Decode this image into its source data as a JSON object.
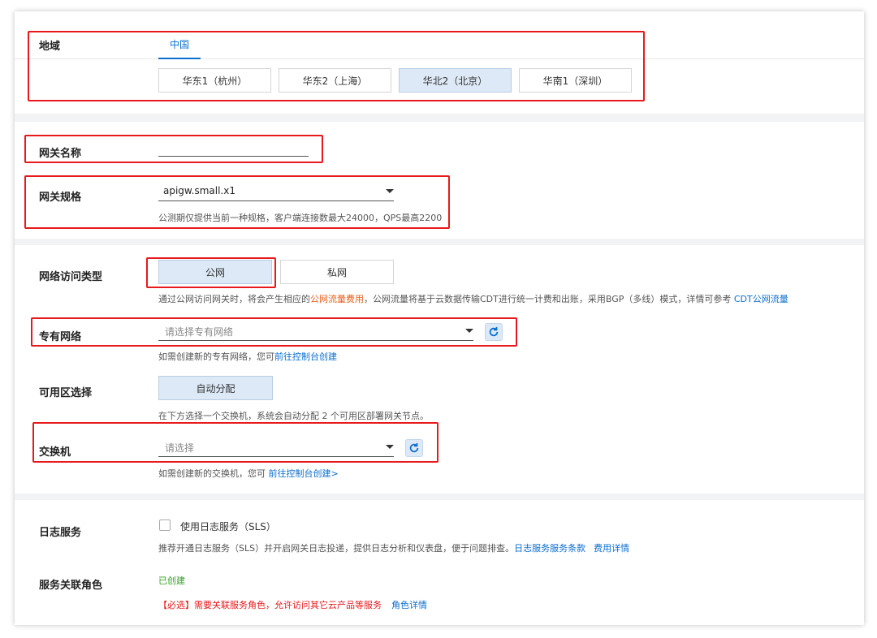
{
  "region": {
    "label": "地域",
    "tab": "中国",
    "options": [
      "华东1（杭州）",
      "华东2（上海）",
      "华北2（北京）",
      "华南1（深圳）"
    ],
    "selected_index": 2
  },
  "gateway_name": {
    "label": "网关名称",
    "value": ""
  },
  "gateway_spec": {
    "label": "网关规格",
    "value": "apigw.small.x1",
    "hint": "公测期仅提供当前一种规格，客户端连接数最大24000，QPS最高2200"
  },
  "network_type": {
    "label": "网络访问类型",
    "options": [
      "公网",
      "私网"
    ],
    "selected_index": 0,
    "hint_part1": "通过公网访问网关时，将会产生相应的",
    "hint_link1": "公网流量费用",
    "hint_part2": "，公网流量将基于云数据传输CDT进行统一计费和出账，采用BGP（多线）模式，详情可参考 ",
    "hint_link2": "CDT公网流量"
  },
  "vpc": {
    "label": "专有网络",
    "placeholder": "请选择专有网络",
    "hint_part1": "如需创建新的专有网络，您可",
    "hint_link": "前往控制台创建"
  },
  "zone": {
    "label": "可用区选择",
    "button": "自动分配",
    "hint": "在下方选择一个交换机，系统会自动分配 2 个可用区部署网关节点。"
  },
  "vswitch": {
    "label": "交换机",
    "placeholder": "请选择",
    "hint_part1": "如需创建新的交换机，您可 ",
    "hint_link": "前往控制台创建>"
  },
  "log_service": {
    "label": "日志服务",
    "checkbox_label": "使用日志服务（SLS）",
    "hint_part1": "推荐开通日志服务（SLS）并开启网关日志投递，提供日志分析和仪表盘，便于问题排查。",
    "hint_link1": "日志服务服务条款",
    "hint_link2": "费用详情"
  },
  "service_role": {
    "label": "服务关联角色",
    "status": "已创建",
    "warning": "【必选】需要关联服务角色，允许访问其它云产品等服务",
    "link": "角色详情"
  },
  "colors": {
    "accent": "#0a6ed1",
    "highlight": "#e8191c",
    "selected_bg": "#dde9f6",
    "success": "#2ea121"
  }
}
